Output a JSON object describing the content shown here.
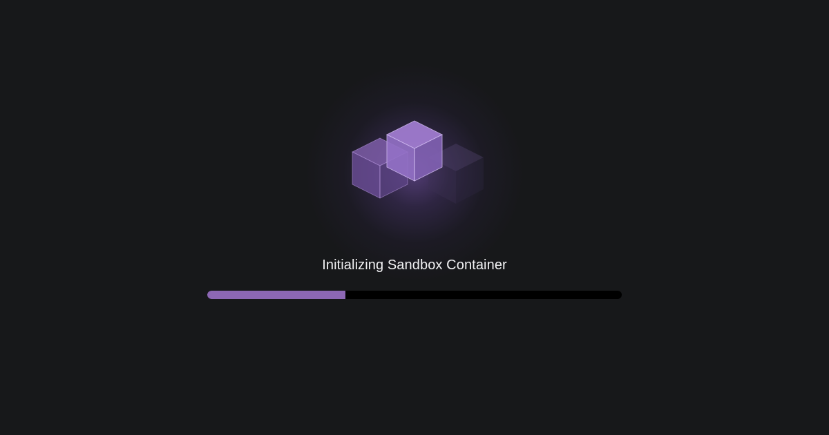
{
  "loader": {
    "title": "Initializing Sandbox Container",
    "progress_fraction": 0.333,
    "icon": "cubes-icon"
  },
  "colors": {
    "background": "#17181a",
    "accent": "#8c67b4",
    "track": "#000000",
    "text": "#f2f2f4"
  }
}
